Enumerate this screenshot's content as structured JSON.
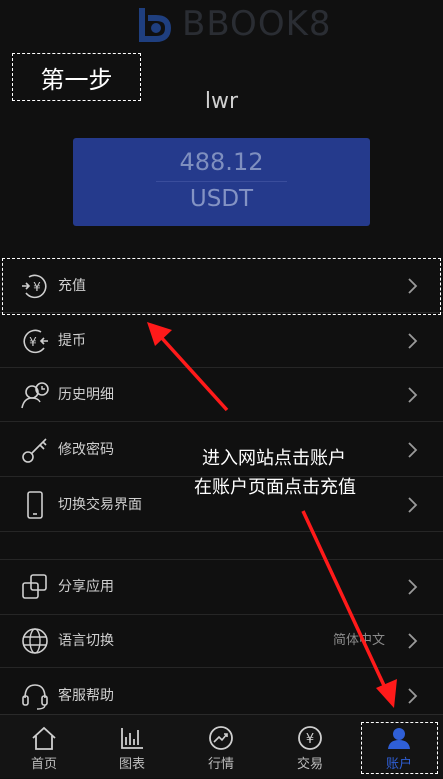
{
  "brand": {
    "name": "BBOOK8",
    "icon": "bbook8-logo"
  },
  "step_label": "第一步",
  "user": {
    "name": "lwr"
  },
  "balance": {
    "amount": "488.12",
    "unit": "USDT"
  },
  "menu": {
    "items": [
      {
        "label": "充值",
        "icon": "yen-deposit-icon"
      },
      {
        "label": "提币",
        "icon": "yen-withdraw-icon"
      },
      {
        "label": "历史明细",
        "icon": "history-icon"
      },
      {
        "label": "修改密码",
        "icon": "key-icon"
      },
      {
        "label": "切换交易界面",
        "icon": "phone-icon"
      },
      {
        "label": "分享应用",
        "icon": "share-icon"
      },
      {
        "label": "语言切换",
        "icon": "globe-icon",
        "value": "简体中文"
      },
      {
        "label": "客服帮助",
        "icon": "headset-icon"
      }
    ]
  },
  "annotation": {
    "line1": "进入网站点击账户",
    "line2": "在账户页面点击充值"
  },
  "nav": {
    "items": [
      {
        "label": "首页",
        "icon": "home-icon"
      },
      {
        "label": "图表",
        "icon": "chart-icon"
      },
      {
        "label": "行情",
        "icon": "trend-icon"
      },
      {
        "label": "交易",
        "icon": "yen-icon"
      },
      {
        "label": "账户",
        "icon": "user-icon",
        "active": true
      }
    ]
  },
  "colors": {
    "background": "#101010",
    "card": "#253a8c",
    "accent": "#2f5fd6",
    "arrow": "#ff0000"
  }
}
